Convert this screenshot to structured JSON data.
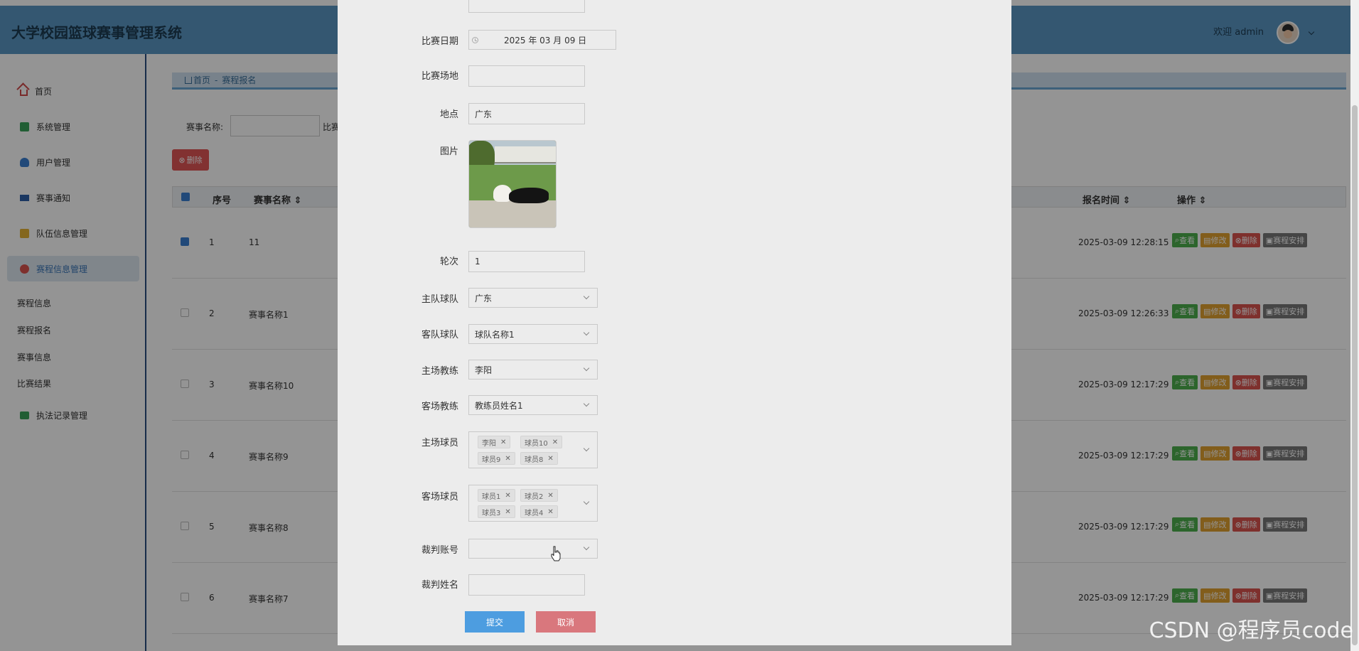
{
  "app": {
    "title": "大学校园篮球赛事管理系统",
    "welcome": "欢迎 admin"
  },
  "sidebar": {
    "items": [
      {
        "label": "首页",
        "icon": "home-icon"
      },
      {
        "label": "系统管理",
        "icon": "system-icon"
      },
      {
        "label": "用户管理",
        "icon": "user-icon"
      },
      {
        "label": "赛事通知",
        "icon": "notice-icon"
      },
      {
        "label": "队伍信息管理",
        "icon": "team-icon"
      },
      {
        "label": "赛程信息管理",
        "icon": "schedule-icon",
        "active": true
      }
    ],
    "sub_items": [
      "赛程信息",
      "赛程报名",
      "赛事信息",
      "比赛结果"
    ],
    "last_item": {
      "label": "执法记录管理",
      "icon": "record-icon"
    }
  },
  "breadcrumb": {
    "home": "首页",
    "separator": "-",
    "current": "赛程报名"
  },
  "filter": {
    "label": "赛事名称:",
    "label2": "比赛"
  },
  "delete_button": "删除",
  "table": {
    "headers": {
      "index": "序号",
      "name": "赛事名称 ⇕",
      "time": "报名时间 ⇕",
      "ops": "操作 ⇕",
      "hidden": "⇕"
    },
    "rows": [
      {
        "index": "1",
        "name": "11",
        "time": "2025-03-09 12:28:15",
        "checked": true
      },
      {
        "index": "2",
        "name": "赛事名称1",
        "time": "2025-03-09 12:26:33",
        "checked": false
      },
      {
        "index": "3",
        "name": "赛事名称10",
        "time": "2025-03-09 12:17:29",
        "checked": false
      },
      {
        "index": "4",
        "name": "赛事名称9",
        "time": "2025-03-09 12:17:29",
        "checked": false
      },
      {
        "index": "5",
        "name": "赛事名称8",
        "time": "2025-03-09 12:17:29",
        "checked": false
      },
      {
        "index": "6",
        "name": "赛事名称7",
        "time": "2025-03-09 12:17:29",
        "checked": false
      }
    ],
    "ops": {
      "view": "查看",
      "edit": "修改",
      "del": "删除",
      "schedule": "赛程安排"
    }
  },
  "form": {
    "date": {
      "label": "比赛日期",
      "value": "2025 年 03 月 09 日"
    },
    "venue": {
      "label": "比赛场地",
      "value": ""
    },
    "location": {
      "label": "地点",
      "value": "广东"
    },
    "image": {
      "label": "图片"
    },
    "round": {
      "label": "轮次",
      "value": "1"
    },
    "home_team": {
      "label": "主队球队",
      "value": "广东"
    },
    "away_team": {
      "label": "客队球队",
      "value": "球队名称1"
    },
    "home_coach": {
      "label": "主场教练",
      "value": "李阳"
    },
    "away_coach": {
      "label": "客场教练",
      "value": "教练员姓名1"
    },
    "home_players": {
      "label": "主场球员",
      "tags": [
        "李阳",
        "球员10",
        "球员9",
        "球员8"
      ]
    },
    "away_players": {
      "label": "客场球员",
      "tags": [
        "球员1",
        "球员2",
        "球员3",
        "球员4"
      ]
    },
    "referee_account": {
      "label": "裁判账号",
      "value": ""
    },
    "referee_name": {
      "label": "裁判姓名",
      "value": ""
    },
    "submit": "提交",
    "cancel": "取消"
  },
  "watermark": "CSDN @程序员code",
  "colors": {
    "topbar": "#5b97c3",
    "submit": "#4d9de0",
    "cancel": "#d9777d",
    "view": "#4cae4c",
    "edit": "#e0a030",
    "del": "#d9534f",
    "schedule": "#777777"
  }
}
